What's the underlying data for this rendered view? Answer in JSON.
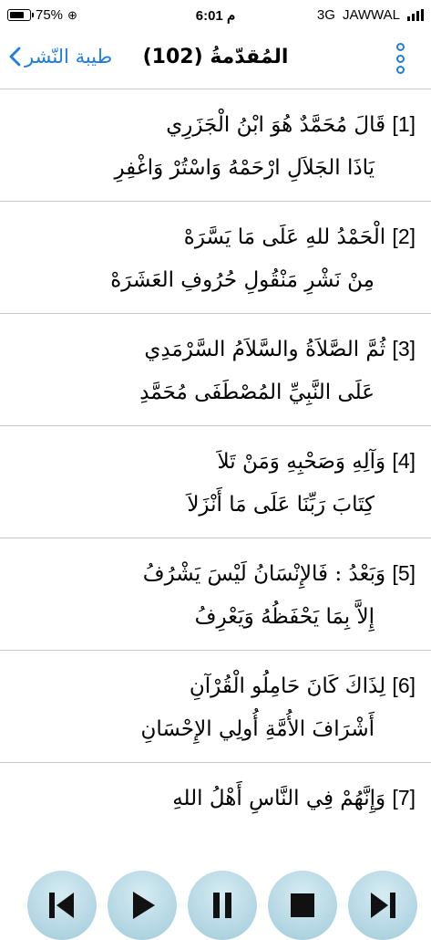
{
  "status_bar": {
    "battery": "75%",
    "time": "6:01 م",
    "network": "3G",
    "carrier": "JAWWAL",
    "battery_level": 0.75
  },
  "nav": {
    "back_label": "طيبة النّشر",
    "title": "المُقدّمةُ (102)",
    "accent_color": "#1e7ee0"
  },
  "verses": [
    {
      "num": "[1]",
      "line1": "قَالَ مُحَمَّدٌ هُوَ ابْنُ الْجَزَرِي",
      "line2": "يَاذَا الجَلاَلِ ارْحَمْهُ وَاسْتُرْ وَاغْفِرِ"
    },
    {
      "num": "[2]",
      "line1": "الْحَمْدُ للهِ عَلَى مَا يَسَّرَهْ",
      "line2": "مِنْ نَشْرِ مَنْقُولِ حُرُوفِ العَشَرَهْ"
    },
    {
      "num": "[3]",
      "line1": "ثُمَّ الصَّلاَةُ والسَّلاَمُ السَّرْمَدِي",
      "line2": "عَلَى النَّبِيِّ المُصْطَفَى مُحَمَّدِ"
    },
    {
      "num": "[4]",
      "line1": "وَآلِهِ وَصَحْبِهِ وَمَنْ تَلاَ",
      "line2": "كِتَابَ رَبِّنَا عَلَى مَا أَنْزَلاَ"
    },
    {
      "num": "[5]",
      "line1": "وَبَعْدُ : فَالإِنْسَانُ لَيْسَ يَشْرُفُ",
      "line2": "إِلاَّ بِمَا يَحْفَظُهُ وَيَعْرِفُ"
    },
    {
      "num": "[6]",
      "line1": "لِذَاكَ كَانَ حَامِلُو الْقُرْآنِ",
      "line2": "أَشْرَافَ الأُمَّةِ أُولِي الإِحْسَانِ"
    },
    {
      "num": "[7]",
      "line1": "وَإِنَّهُمْ فِي النَّاسِ أَهْلُ اللهِ",
      "line2": ""
    }
  ],
  "controls": {
    "items": [
      "skip-back-icon",
      "play-icon",
      "pause-icon",
      "stop-icon",
      "skip-forward-icon"
    ],
    "button_color": "#b6d8e4",
    "icon_color": "#111111"
  }
}
